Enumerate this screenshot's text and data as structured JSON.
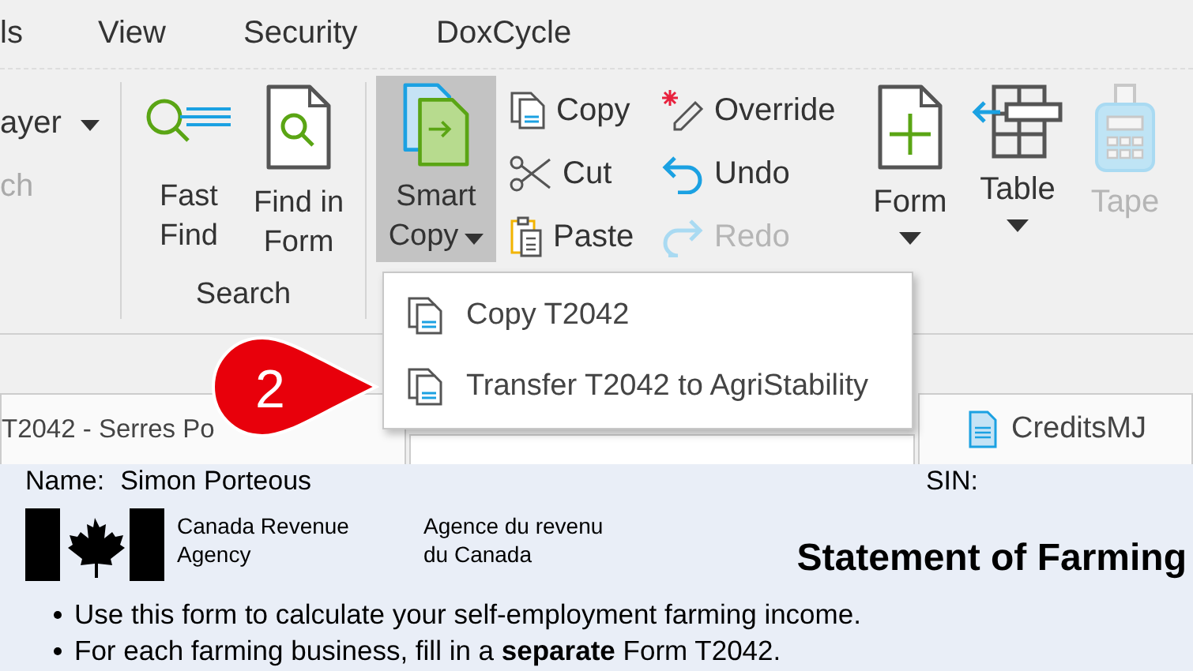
{
  "menu_tabs": [
    {
      "label": "ls"
    },
    {
      "label": "View"
    },
    {
      "label": "Security"
    },
    {
      "label": "DoxCycle"
    }
  ],
  "partial_group": {
    "items": [
      {
        "label": "ayer",
        "dropdown": true,
        "disabled": false
      },
      {
        "label": "ch",
        "dropdown": false,
        "disabled": true
      }
    ]
  },
  "search_group": {
    "label": "Search",
    "buttons": [
      {
        "kind": "fast-find",
        "label": "Fast\nFind"
      },
      {
        "kind": "find-in-form",
        "label": "Find in\nForm"
      }
    ]
  },
  "smart_copy": {
    "label": "Smart\nCopy",
    "open": true
  },
  "small_buttons": [
    {
      "kind": "copy",
      "label": "Copy",
      "disabled": false
    },
    {
      "kind": "cut",
      "label": "Cut",
      "disabled": false
    },
    {
      "kind": "paste",
      "label": "Paste",
      "disabled": false
    },
    {
      "kind": "override",
      "label": "Override",
      "disabled": false
    },
    {
      "kind": "undo",
      "label": "Undo",
      "disabled": false
    },
    {
      "kind": "redo",
      "label": "Redo",
      "disabled": true
    }
  ],
  "large_buttons": [
    {
      "kind": "form",
      "label": "Form",
      "dropdown": true,
      "disabled": false
    },
    {
      "kind": "table",
      "label": "Table",
      "dropdown": true,
      "disabled": false
    },
    {
      "kind": "tape",
      "label": "Tape",
      "dropdown": false,
      "disabled": true
    }
  ],
  "tabs": [
    {
      "label": "T2042 - Serres Po",
      "selected": false
    },
    {
      "label": "CreditsMJ",
      "selected": false
    }
  ],
  "dropdown_menu": [
    {
      "label": "Copy T2042"
    },
    {
      "label": "Transfer T2042 to AgriStability"
    }
  ],
  "callout": {
    "number": "2"
  },
  "form": {
    "name_label": "Name:",
    "name": "Simon Porteous",
    "sin_label": "SIN:",
    "agency_en": "Canada Revenue\nAgency",
    "agency_fr": "Agence du revenu\ndu Canada",
    "title": "Statement of Farming",
    "bullets": [
      "Use this form to calculate your self-employment farming income.",
      "For each farming business, fill in a **separate** Form T2042."
    ]
  }
}
